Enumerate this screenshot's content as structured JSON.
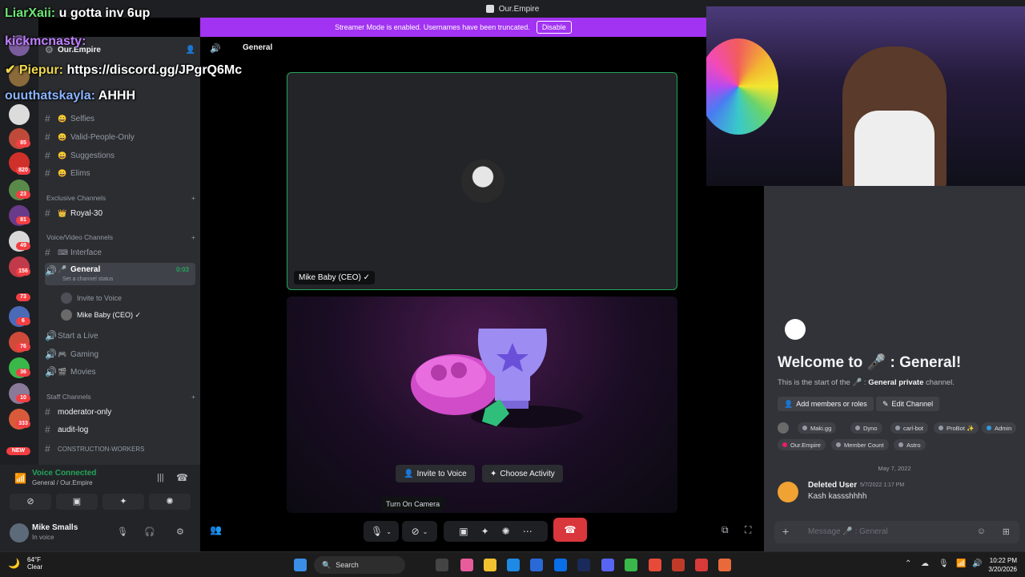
{
  "window": {
    "title": "Our.Empire"
  },
  "banner": {
    "text": "Streamer Mode is enabled. Usernames have been truncated.",
    "button": "Disable"
  },
  "server_rail": {
    "badges": [
      "85",
      "820",
      "23",
      "81",
      "49",
      "156",
      "73",
      "6",
      "76",
      "36",
      "10",
      "333"
    ],
    "new_label": "NEW"
  },
  "sidebar": {
    "server_name": "Our.Empire",
    "channels_top": [
      {
        "name": "Selfies",
        "emoji": "😀"
      },
      {
        "name": "Valid-People-Only",
        "emoji": "😀"
      },
      {
        "name": "Suggestions",
        "emoji": "😀"
      },
      {
        "name": "Elims",
        "emoji": "😀"
      }
    ],
    "cat_exclusive": "Exclusive Channels",
    "royal": "Royal-30",
    "cat_voice": "Voice/Video Channels",
    "interface": "Interface",
    "general": "General",
    "general_time": "0:03",
    "channel_status": "Set a channel status",
    "invite_to_voice": "Invite to Voice",
    "member": "Mike Baby (CEO) ✓",
    "start_live": "Start a Live",
    "gaming": "Gaming",
    "movies": "Movies",
    "cat_staff": "Staff Channels",
    "moderator": "moderator-only",
    "audit": "audit-log",
    "construction": "CONSTRUCTION-WORKERS"
  },
  "voice_panel": {
    "status": "Voice Connected",
    "channel": "General / Our.Empire"
  },
  "user_panel": {
    "name": "Mike Smalls",
    "status": "In voice"
  },
  "stage": {
    "channel_title": "General",
    "participant_name": "Mike Baby (CEO) ✓",
    "invite_button": "Invite to Voice",
    "activity_button": "Choose Activity",
    "tooltip": "Turn On Camera"
  },
  "chat": {
    "welcome": "Welcome to 🎤 : General!",
    "start_prefix": "This is the start of the 🎤 : ",
    "start_channel": "General private",
    "start_suffix": " channel.",
    "add_members": "Add members or roles",
    "edit_channel": "Edit Channel",
    "roles": [
      {
        "name": "Maki.gg",
        "color": "#949ba4"
      },
      {
        "name": "Dyno",
        "color": "#949ba4"
      },
      {
        "name": "carl-bot",
        "color": "#949ba4"
      },
      {
        "name": "ProBot ✨",
        "color": "#949ba4"
      },
      {
        "name": "Admin",
        "color": "#3498db"
      },
      {
        "name": "Our.Empire",
        "color": "#e91e63"
      },
      {
        "name": "Member Count",
        "color": "#949ba4"
      },
      {
        "name": "Astro",
        "color": "#949ba4"
      }
    ],
    "date_divider": "May 7, 2022",
    "message": {
      "author": "Deleted User",
      "time": "5/7/2022 1:17 PM",
      "text": "Kash kassshhhh"
    },
    "input_placeholder": "Message 🎤 : General"
  },
  "overlay_chat": [
    {
      "user": "LiarXaii:",
      "text": "u gotta inv 6up",
      "color": "#6be675"
    },
    {
      "user": "kickmcnasty:",
      "text": "",
      "color": "#c080ff"
    },
    {
      "user": "Piepur:",
      "text": "https://discord.gg/JPgrQ6Mc",
      "color": "#f0d850"
    },
    {
      "user": "ouuthatskayla:",
      "text": "AHHH",
      "color": "#8ab4ff"
    }
  ],
  "taskbar": {
    "temp": "64°F",
    "weather": "Clear",
    "search": "Search",
    "time": "10:22 PM",
    "date": "3/20/2026"
  }
}
